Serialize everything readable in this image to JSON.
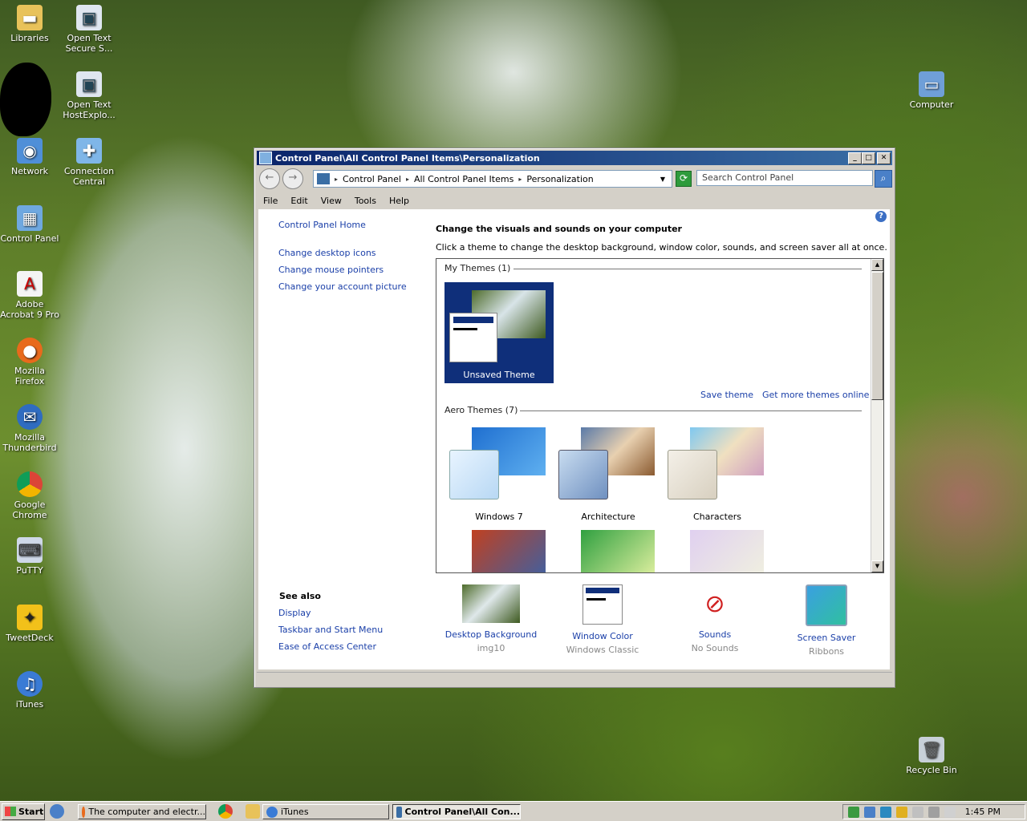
{
  "desktop": {
    "icons_left": [
      {
        "label": "Libraries"
      },
      {
        "label": "Network"
      },
      {
        "label": "Control Panel"
      },
      {
        "label": "Adobe Acrobat 9 Pro"
      },
      {
        "label": "Mozilla Firefox"
      },
      {
        "label": "Mozilla Thunderbird"
      },
      {
        "label": "Google Chrome"
      },
      {
        "label": "PuTTY"
      },
      {
        "label": "TweetDeck"
      },
      {
        "label": "iTunes"
      }
    ],
    "icons_col2": [
      {
        "label": "Open Text Secure S..."
      },
      {
        "label": "Open Text HostExplo..."
      },
      {
        "label": "Connection Central"
      }
    ],
    "icons_right": [
      {
        "label": "Computer"
      },
      {
        "label": "Recycle Bin"
      }
    ]
  },
  "window": {
    "title": "Control Panel\\All Control Panel Items\\Personalization",
    "breadcrumb": [
      "Control Panel",
      "All Control Panel Items",
      "Personalization"
    ],
    "search_placeholder": "Search Control Panel",
    "menu": [
      "File",
      "Edit",
      "View",
      "Tools",
      "Help"
    ],
    "sidebar": {
      "home": "Control Panel Home",
      "links": [
        "Change desktop icons",
        "Change mouse pointers",
        "Change your account picture"
      ],
      "see_also_title": "See also",
      "see_also": [
        "Display",
        "Taskbar and Start Menu",
        "Ease of Access Center"
      ]
    },
    "main": {
      "heading": "Change the visuals and sounds on your computer",
      "subheading": "Click a theme to change the desktop background, window color, sounds, and screen saver all at once.",
      "my_themes_label": "My Themes (1)",
      "unsaved_theme": "Unsaved Theme",
      "save_theme": "Save theme",
      "get_more": "Get more themes online",
      "aero_label": "Aero Themes (7)",
      "aero_themes": [
        "Windows 7",
        "Architecture",
        "Characters"
      ]
    },
    "bottom": [
      {
        "title": "Desktop Background",
        "sub": "img10"
      },
      {
        "title": "Window Color",
        "sub": "Windows Classic"
      },
      {
        "title": "Sounds",
        "sub": "No Sounds"
      },
      {
        "title": "Screen Saver",
        "sub": "Ribbons"
      }
    ]
  },
  "taskbar": {
    "start": "Start",
    "tasks": [
      "The computer and electr...",
      "iTunes",
      "Control Panel\\All Con..."
    ],
    "clock": "1:45 PM"
  },
  "colors": {
    "link": "#1a3fa8",
    "title_bar": "#0a246a",
    "selected_theme": "#0f2f7a"
  }
}
